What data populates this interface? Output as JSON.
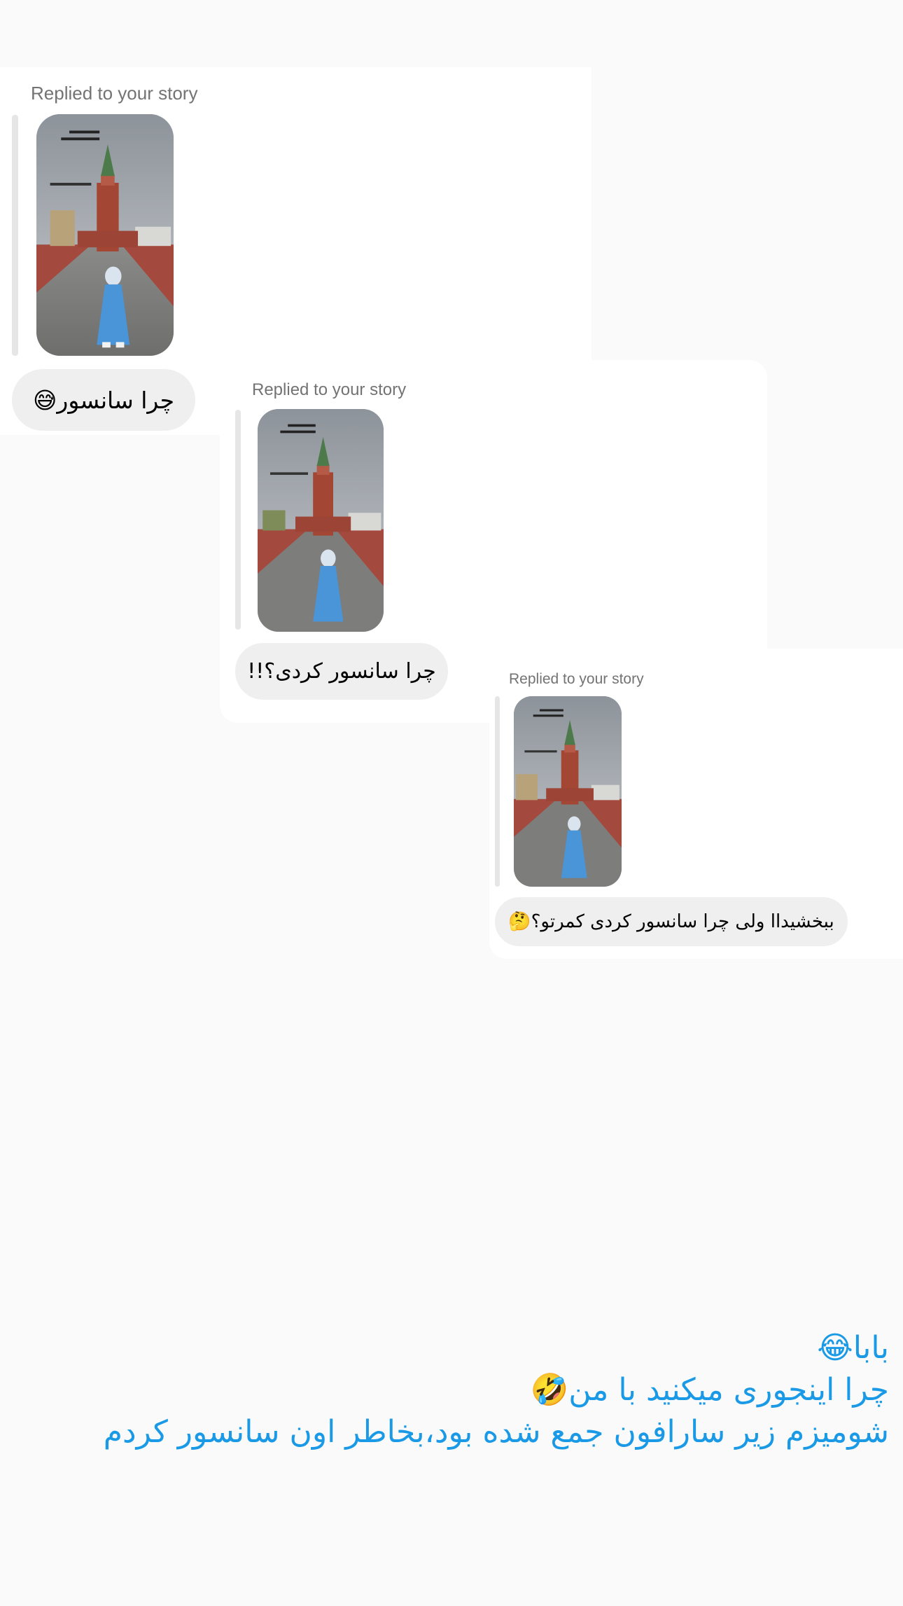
{
  "messages": [
    {
      "reply_label": "Replied to your story",
      "story_thumbnail": "story-photo",
      "text": "چرا سانسور😅"
    },
    {
      "reply_label": "Replied to your story",
      "story_thumbnail": "story-photo",
      "text": "چرا سانسور کردی؟!!"
    },
    {
      "reply_label": "Replied to your story",
      "story_thumbnail": "story-photo",
      "text": "ببخشیداا ولی چرا سانسور کردی کمرتو؟🤔"
    }
  ],
  "caption": {
    "lines": [
      "بابا😂",
      "چرا اینجوری میکنید با من🤣",
      "شومیزم  زیر سارافون جمع شده بود،بخاطر اون سانسور کردم"
    ],
    "color": "#1a9ae6"
  },
  "colors": {
    "background": "#fafafa",
    "card": "#ffffff",
    "bubble": "#efefef",
    "label": "#737373"
  }
}
